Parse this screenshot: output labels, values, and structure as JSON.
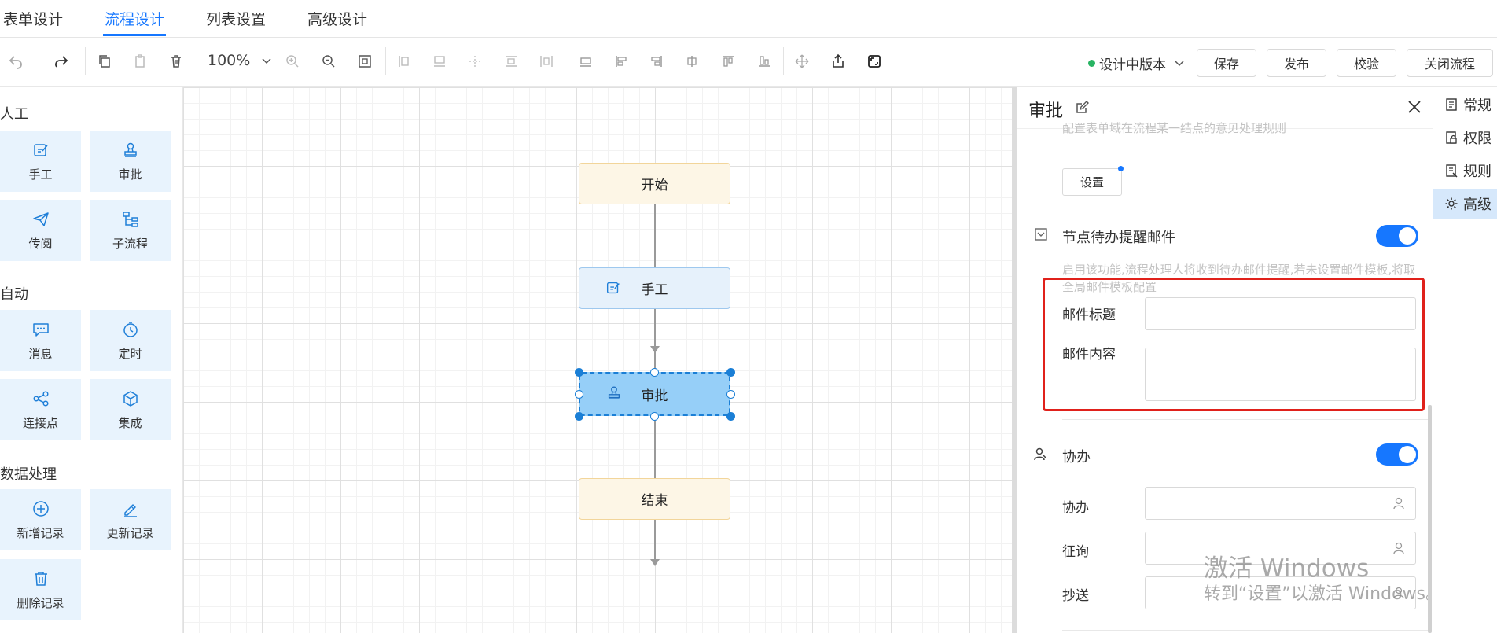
{
  "tabs": {
    "form": "表单设计",
    "process": "流程设计",
    "list": "列表设置",
    "advanced": "高级设计"
  },
  "toolbar": {
    "zoom": "100%",
    "version": "设计中版本",
    "save": "保存",
    "publish": "发布",
    "validate": "校验",
    "close": "关闭流程",
    "status_color": "#28b463"
  },
  "palette": {
    "group_manual": "人工",
    "group_auto": "自动",
    "group_data": "数据处理",
    "items": {
      "manual": "手工",
      "approve": "审批",
      "circulate": "传阅",
      "subprocess": "子流程",
      "message": "消息",
      "timer": "定时",
      "connector": "连接点",
      "integration": "集成",
      "add_record": "新增记录",
      "update_record": "更新记录",
      "delete_record": "删除记录"
    }
  },
  "canvas": {
    "nodes": {
      "start": "开始",
      "manual": "手工",
      "approve": "审批",
      "end": "结束"
    }
  },
  "panel": {
    "title": "审批",
    "opinion_desc": "配置表单域在流程某一结点的意见处理规则",
    "set_button": "设置",
    "reminder_title": "节点待办提醒邮件",
    "reminder_enabled": true,
    "reminder_desc": "启用该功能,流程处理人将收到待办邮件提醒,若未设置邮件模板,将取全局邮件模板配置",
    "mail_subject_label": "邮件标题",
    "mail_subject_value": "",
    "mail_content_label": "邮件内容",
    "mail_content_value": "",
    "assist_title": "协办",
    "assist_enabled": true,
    "assist_label": "协办",
    "consult_label": "征询",
    "cc_label": "抄送",
    "highlight_color": "#e0211b"
  },
  "side_tabs": {
    "general": "常规",
    "permission": "权限",
    "rules": "规则",
    "advanced": "高级"
  },
  "watermark": {
    "line1": "激活 Windows",
    "line2": "转到“设置”以激活 Windows。"
  }
}
